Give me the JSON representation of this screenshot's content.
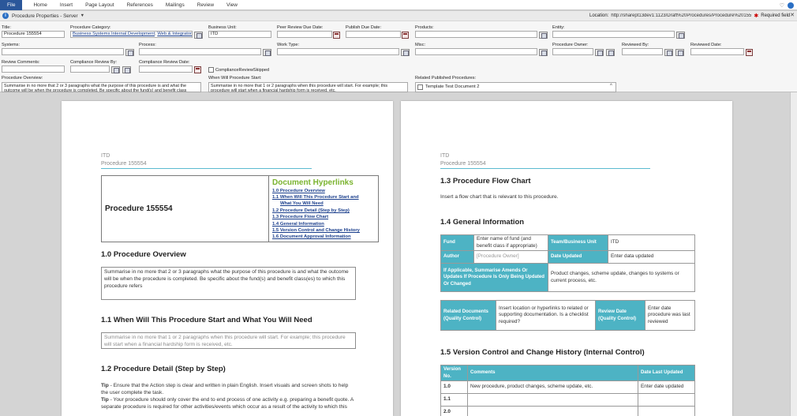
{
  "ribbon": {
    "tabs": [
      "File",
      "Home",
      "Insert",
      "Page Layout",
      "References",
      "Mailings",
      "Review",
      "View"
    ]
  },
  "propbar": {
    "title": "Procedure Properties - Server",
    "location_label": "Location:",
    "location_value": "http://sharept13dev1:1123/Draft%20Procedures/Procedure%20155554",
    "required_label": "Required field",
    "fields": {
      "title_label": "Title:",
      "title_value": "Procedure 155554",
      "category_label": "Procedure Category:",
      "category_value_1": "Business Systems Internal Development",
      "category_value_2": "Web & Integrator",
      "unit_label": "Business Unit:",
      "unit_value": "ITD",
      "peer_label": "Peer Review Due Date:",
      "publish_label": "Publish Due Date:",
      "products_label": "Products:",
      "entity_label": "Entity:",
      "systems_label": "Systems:",
      "process_label": "Process:",
      "worktype_label": "Work Type:",
      "misc_label": "Misc:",
      "owner_label": "Procedure Owner:",
      "reviewed_by_label": "Reviewed By:",
      "reviewed_date_label": "Reviewed Date:",
      "review_comments_label": "Review Comments:",
      "compliance_by_label": "Compliance Review By:",
      "compliance_date_label": "Compliance Review Date:",
      "compliance_skip_label": "ComplianceReviewSkipped",
      "overview_label": "Procedure Overview:",
      "overview_value": "Summarise in no more that 2 or 3 paragraphs what the purpose of this procedure is and what the outcome will be when the procedure is completed. Be specific about the fund(s) and benefit class",
      "when_label": "When Will Procedure Start:",
      "when_value": "Summarise in no more that 1 or 2 paragraphs when this procedure will start. For example; this procedure will start when a financial hardship form is received, etc.",
      "related_label": "Related Published Procedures:",
      "related_value": "Template Test Document 2"
    }
  },
  "page1": {
    "header_org": "ITD",
    "header_proc": "Procedure 155554",
    "proc_title": "Procedure 155554",
    "hyperlinks_title": "Document Hyperlinks",
    "hyperlinks": [
      "1.0 Procedure Overview",
      "1.1 When Will This Procedure Start and",
      "What You Will Need",
      "1.2 Procedure Detail (Step by Step)",
      "1.3 Procedure Flow Chart",
      "1.4 General Information",
      "1.5 Version Control and Change History",
      "1.6 Document Approval Information"
    ],
    "h_overview": "1.0 Procedure Overview",
    "overview_text": "Summarise in no more that 2 or 3 paragraphs what the purpose of this procedure is and what the outcome will be when the procedure is completed. Be specific about the fund(s) and benefit class(es) to which this procedure refers",
    "h_when": "1.1 When Will This Procedure Start and What You Will Need",
    "when_text": "Summarise in no more that 1 or 2 paragraphs when this procedure will start. For example; this procedure will start when a financial hardship form is received, etc.",
    "h_detail": "1.2 Procedure Detail (Step by Step)",
    "tip_label": "Tip",
    "tip1": " - Ensure that the Action step is clear and written in plain English. Insert visuals and screen shots to help the user complete the task.",
    "tip2": " - Your procedure should only cover the end to end process of one activity e.g. preparing a benefit quote. A separate procedure is required for other activities/events which occur as a result of the activity to which this"
  },
  "page2": {
    "header_org": "ITD",
    "header_proc": "Procedure 155554",
    "h_flow": "1.3 Procedure Flow Chart",
    "flow_text": "Insert a flow chart that is relevant to this procedure.",
    "h_general": "1.4 General Information",
    "general": {
      "fund_label": "Fund",
      "fund_value": "Enter name of fund (and benefit class if appropriate)",
      "team_label": "Team/Business Unit",
      "team_value": "ITD",
      "author_label": "Author",
      "author_value": "[Procedure Owner]",
      "updated_label": "Date Updated",
      "updated_value": "Enter data updated",
      "amend_label": "If Applicable, Summarise Amends Or Updates If Procedure Is Only Being Updated Or Changed",
      "amend_value": "Product changes, scheme update, changes to systems or current process, etc.",
      "related_label": "Related Documents (Quality Control)",
      "related_value": "Insert location or hyperlinks to related or supporting documentation. Is a checklist required?",
      "review_label": "Review Date (Quality Control)",
      "review_value": "Enter date procedure was last reviewed"
    },
    "h_version": "1.5 Version Control and Change History (Internal Control)",
    "version": {
      "col_version": "Version No.",
      "col_comments": "Comments",
      "col_date": "Date Last Updated",
      "rows": [
        {
          "v": "1.0",
          "c": "New procedure, product changes, scheme update, etc.",
          "d": "Enter date updated"
        },
        {
          "v": "1.1",
          "c": "",
          "d": ""
        },
        {
          "v": "2.0",
          "c": "",
          "d": ""
        }
      ]
    }
  }
}
